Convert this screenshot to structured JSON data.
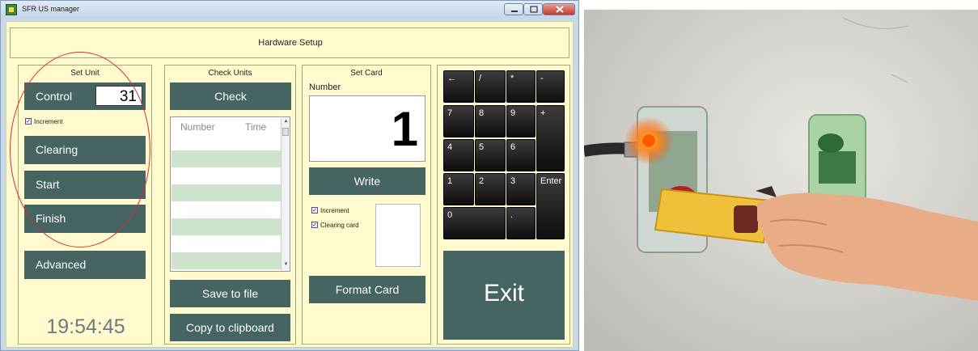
{
  "window": {
    "title": "SFR US manager"
  },
  "header": {
    "title": "Hardware Setup"
  },
  "set_unit": {
    "title": "Set Unit",
    "control_label": "Control",
    "control_value": "31",
    "increment_label": "Increment",
    "increment_checked": true,
    "clearing_label": "Clearing",
    "start_label": "Start",
    "finish_label": "Finish",
    "advanced_label": "Advanced",
    "clock": "19:54:45"
  },
  "check_units": {
    "title": "Check Units",
    "check_label": "Check",
    "columns": [
      "Number",
      "Time"
    ],
    "rows": [],
    "save_label": "Save to file",
    "copy_label": "Copy to clipboard"
  },
  "set_card": {
    "title": "Set Card",
    "number_label": "Number",
    "number_value": "1",
    "write_label": "Write",
    "increment_label": "Increment",
    "clearing_card_label": "Clearing card",
    "format_label": "Format Card"
  },
  "keypad": {
    "keys": [
      "←",
      "/",
      "*",
      "-",
      "7",
      "8",
      "9",
      "+",
      "4",
      "5",
      "6",
      "1",
      "2",
      "3",
      "Enter",
      "0",
      "."
    ],
    "exit_label": "Exit"
  },
  "colors": {
    "button": "#466462",
    "panel": "#fffbcf",
    "highlight_ellipse": "#d63030"
  }
}
